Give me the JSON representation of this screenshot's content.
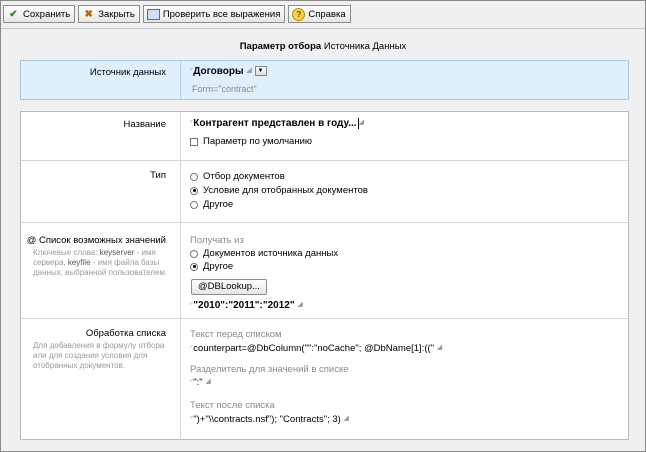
{
  "toolbar": {
    "save": "Сохранить",
    "close": "Закрыть",
    "check_all": "Проверить все выражения",
    "help": "Справка"
  },
  "title": {
    "bold": "Параметр отбора",
    "rest": "Источника Данных"
  },
  "source": {
    "label": "Источник данных",
    "value": "Договоры",
    "formula": "Form=\"contract\""
  },
  "name": {
    "label": "Название",
    "value": "Контрагент представлен в году...",
    "default_label": "Параметр по умолчанию"
  },
  "type": {
    "label": "Тип",
    "options": [
      "Отбор документов",
      "Условие для отобранных документов",
      "Другое"
    ],
    "selected": 1
  },
  "values": {
    "label": "@ Список возможных значений",
    "hint_1": "Ключевые слова: ",
    "hint_kw1": "keyserver",
    "hint_2": " - имя сервера, ",
    "hint_kw2": "keyfile",
    "hint_3": " - имя файла базы данных, выбранной пользователем.",
    "get_from": "Получать из",
    "options": [
      "Документов источника данных",
      "Другое"
    ],
    "selected": 1,
    "lookup_button": "@DBLookup...",
    "value": "\"2010\":\"2011\":\"2012\""
  },
  "processing": {
    "label": "Обработка списка",
    "hint": "Для добавления в формулу отбора или для создания условия для отобранных документов.",
    "before_label": "Текст перед списком",
    "before_value": "counterpart=@DbColumn(\"\":\"noCache\"; @DbName[1]:((\"",
    "sep_label": "Разделитель для значений в списке",
    "sep_value": "\":\"",
    "after_label": "Текст после списка",
    "after_value": "\")+\"\\\\contracts.nsf\"); \"Contracts\"; 3)"
  }
}
